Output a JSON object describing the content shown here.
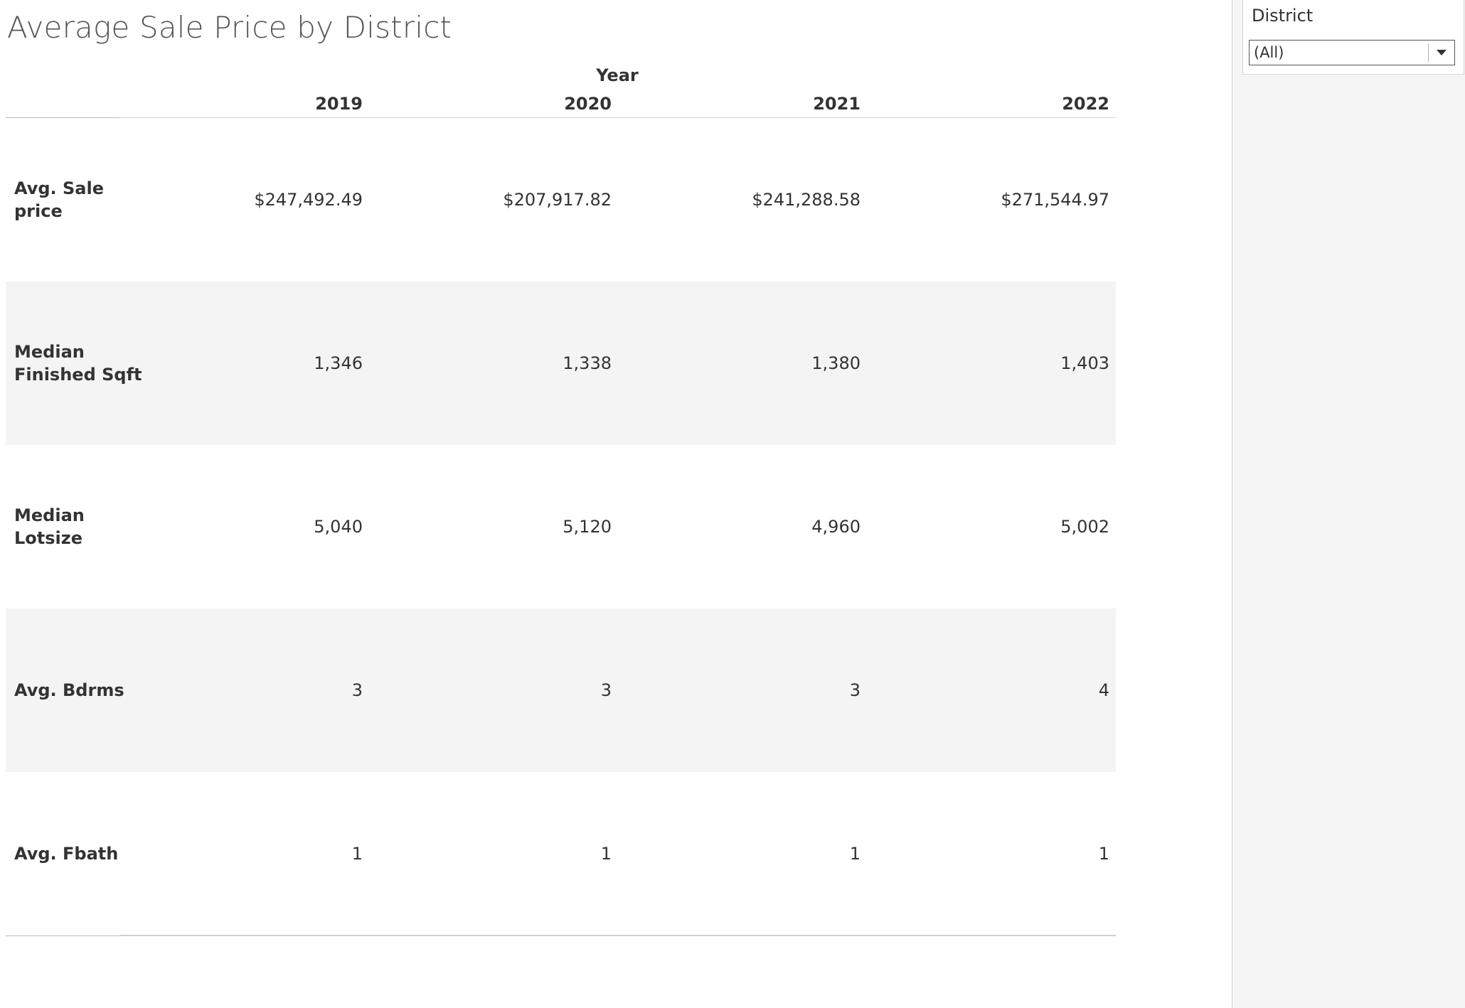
{
  "title": "Average Sale Price by District",
  "table": {
    "column_group_label": "Year",
    "columns": [
      "2019",
      "2020",
      "2021",
      "2022"
    ],
    "rows": [
      {
        "label": "Avg. Sale\nprice",
        "values": [
          "$247,492.49",
          "$207,917.82",
          "$241,288.58",
          "$271,544.97"
        ]
      },
      {
        "label": "Median\nFinished Sqft",
        "values": [
          "1,346",
          "1,338",
          "1,380",
          "1,403"
        ]
      },
      {
        "label": "Median\nLotsize",
        "values": [
          "5,040",
          "5,120",
          "4,960",
          "5,002"
        ]
      },
      {
        "label": "Avg. Bdrms",
        "values": [
          "3",
          "3",
          "3",
          "4"
        ]
      },
      {
        "label": "Avg. Fbath",
        "values": [
          "1",
          "1",
          "1",
          "1"
        ]
      }
    ]
  },
  "filter": {
    "title": "District",
    "selected_value": "(All)",
    "arrow_icon": "caret-down-icon"
  },
  "colors": {
    "row_shading": "#f4f4f4",
    "text": "#333333",
    "title": "#555555"
  }
}
